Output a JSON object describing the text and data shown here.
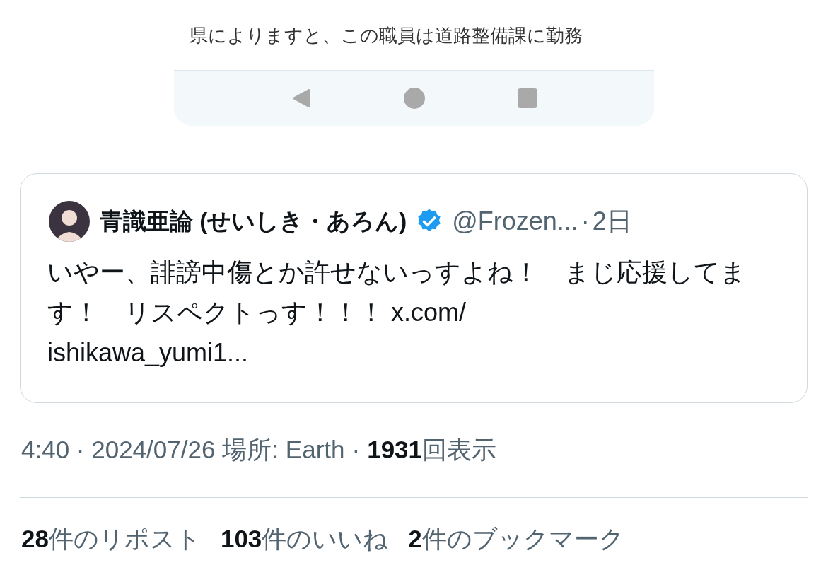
{
  "article_screenshot": {
    "lines": [
      "県によりますと、この職員は道路整備課に勤務"
    ]
  },
  "nav_bar": {
    "buttons": [
      {
        "kind": "back"
      },
      {
        "kind": "home"
      },
      {
        "kind": "recents"
      }
    ]
  },
  "quoted_post": {
    "name": "青識亜論 (せいしき・あろん)",
    "verified": true,
    "handle": "@Frozen...",
    "separator": "·",
    "time": "2日",
    "text": "いやー、誹謗中傷とか許せないっすよね！　まじ応援してます！　リスペクトっす！！！ x.com/\nishikawa_yumi1..."
  },
  "meta": {
    "time": "4:40 · 2024/07/26",
    "location": "場所: Earth",
    "separator": "·",
    "views": "1931",
    "views_label": "回表示"
  },
  "stats": [
    {
      "count": "28",
      "label": "件のリポスト"
    },
    {
      "count": "103",
      "label": "件のいいね"
    },
    {
      "count": "2",
      "label": "件のブックマーク"
    }
  ]
}
